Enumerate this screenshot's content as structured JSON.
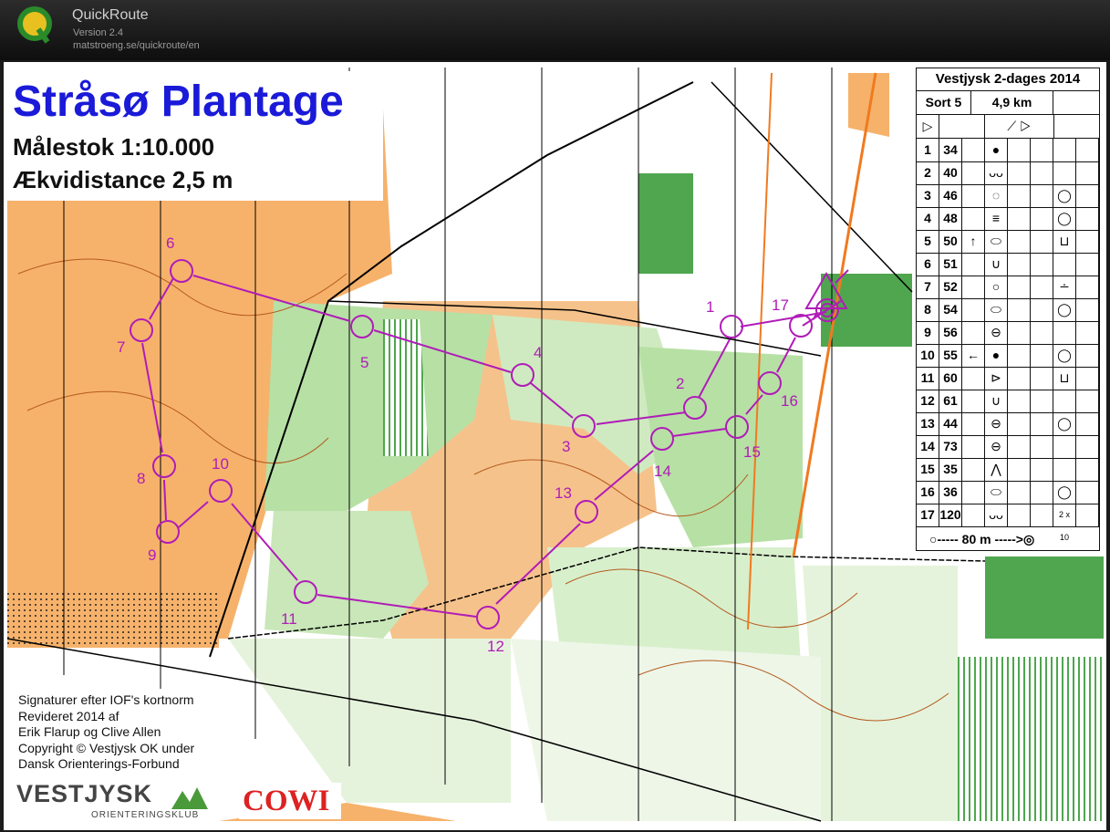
{
  "app": {
    "name": "QuickRoute",
    "version": "Version 2.4",
    "url": "matstroeng.se/quickroute/en"
  },
  "map": {
    "title": "Stråsø Plantage",
    "scale": "Målestok 1:10.000",
    "equidistance": "Ækvidistance 2,5 m",
    "credits": [
      "Signaturer efter IOF's kortnorm",
      "Revideret 2014 af",
      "Erik Flarup og Clive Allen",
      "Copyright © Vestjysk OK under",
      "Dansk Orienterings-Forbund"
    ],
    "club": {
      "name": "VESTJYSK",
      "sub": "ORIENTERINGSKLUB"
    },
    "sponsor": "COWI",
    "course_color": "#b01cb8",
    "control_labels": [
      "1",
      "2",
      "3",
      "4",
      "5",
      "6",
      "7",
      "8",
      "9",
      "10",
      "11",
      "12",
      "13",
      "14",
      "15",
      "16",
      "17"
    ]
  },
  "legend": {
    "event": "Vestjysk 2-dages 2014",
    "course": "Sort 5",
    "length": "4,9 km",
    "controls": [
      {
        "num": "1",
        "code": "34",
        "extra": "",
        "feature": "●",
        "detail": ""
      },
      {
        "num": "2",
        "code": "40",
        "extra": "",
        "feature": "ᴗᴗ",
        "detail": ""
      },
      {
        "num": "3",
        "code": "46",
        "extra": "",
        "feature": "◌",
        "detail": "◯"
      },
      {
        "num": "4",
        "code": "48",
        "extra": "",
        "feature": "≡",
        "detail": "◯"
      },
      {
        "num": "5",
        "code": "50",
        "extra": "↑",
        "feature": "⬭",
        "detail": "⊔"
      },
      {
        "num": "6",
        "code": "51",
        "extra": "",
        "feature": "∪",
        "detail": ""
      },
      {
        "num": "7",
        "code": "52",
        "extra": "",
        "feature": "○",
        "detail": "∸"
      },
      {
        "num": "8",
        "code": "54",
        "extra": "",
        "feature": "⬭",
        "detail": "◯"
      },
      {
        "num": "9",
        "code": "56",
        "extra": "",
        "feature": "⊖",
        "detail": ""
      },
      {
        "num": "10",
        "code": "55",
        "extra": "←",
        "feature": "●",
        "detail": "◯"
      },
      {
        "num": "11",
        "code": "60",
        "extra": "",
        "feature": "⊳",
        "detail": "⊔"
      },
      {
        "num": "12",
        "code": "61",
        "extra": "",
        "feature": "∪",
        "detail": ""
      },
      {
        "num": "13",
        "code": "44",
        "extra": "",
        "feature": "⊖",
        "detail": "◯"
      },
      {
        "num": "14",
        "code": "73",
        "extra": "",
        "feature": "⊖",
        "detail": ""
      },
      {
        "num": "15",
        "code": "35",
        "extra": "",
        "feature": "⋀",
        "detail": ""
      },
      {
        "num": "16",
        "code": "36",
        "extra": "",
        "feature": "⬭",
        "detail": "◯"
      },
      {
        "num": "17",
        "code": "120",
        "extra": "",
        "feature": "ᴗᴗ",
        "detail": "2 x 10"
      }
    ],
    "finish": "○----- 80 m ----->◎"
  }
}
